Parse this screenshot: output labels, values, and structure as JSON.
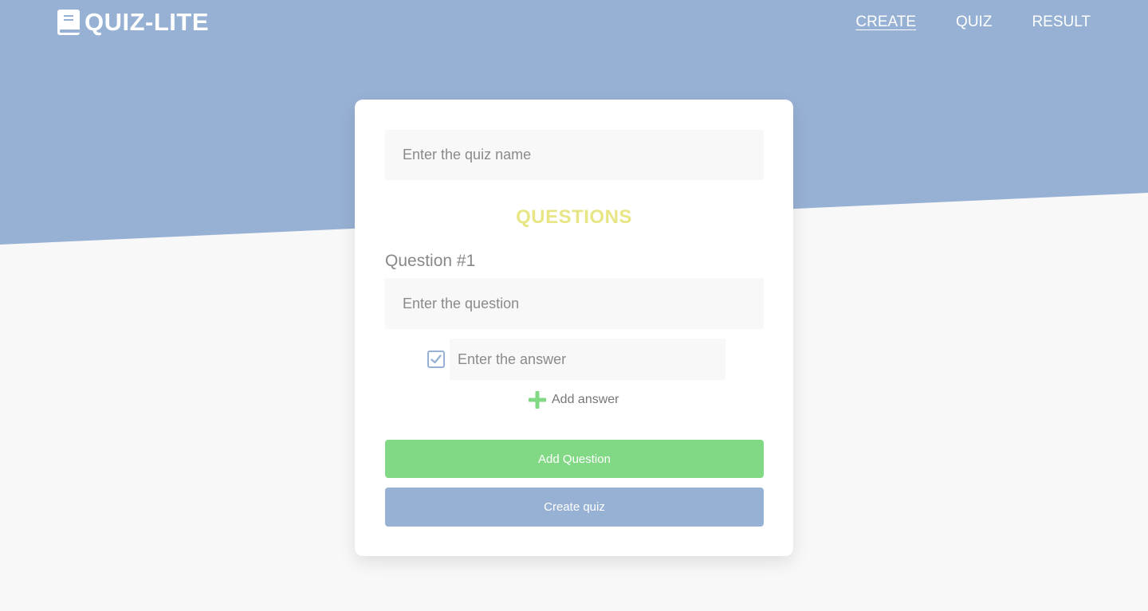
{
  "colors": {
    "header_bg": "#97b1d4",
    "page_bg": "#f8f8f8",
    "card_bg": "#ffffff",
    "accent_yellow": "#e8e585",
    "accent_green": "#81d985",
    "accent_blue": "#97b1d4"
  },
  "header": {
    "logo_icon": "book-icon",
    "logo_text": "QUIZ-LITE",
    "nav": [
      {
        "label": "CREATE",
        "active": true
      },
      {
        "label": "QUIZ",
        "active": false
      },
      {
        "label": "RESULT",
        "active": false
      }
    ]
  },
  "form": {
    "quiz_name": {
      "value": "",
      "placeholder": "Enter the quiz name"
    },
    "section_title": "QUESTIONS",
    "questions": [
      {
        "label": "Question #1",
        "question": {
          "value": "",
          "placeholder": "Enter the question"
        },
        "answers": [
          {
            "checked": true,
            "value": "",
            "placeholder": "Enter the answer"
          }
        ],
        "add_answer_icon": "plus-icon",
        "add_answer_label": "Add answer"
      }
    ],
    "add_question_label": "Add Question",
    "create_quiz_label": "Create quiz"
  }
}
